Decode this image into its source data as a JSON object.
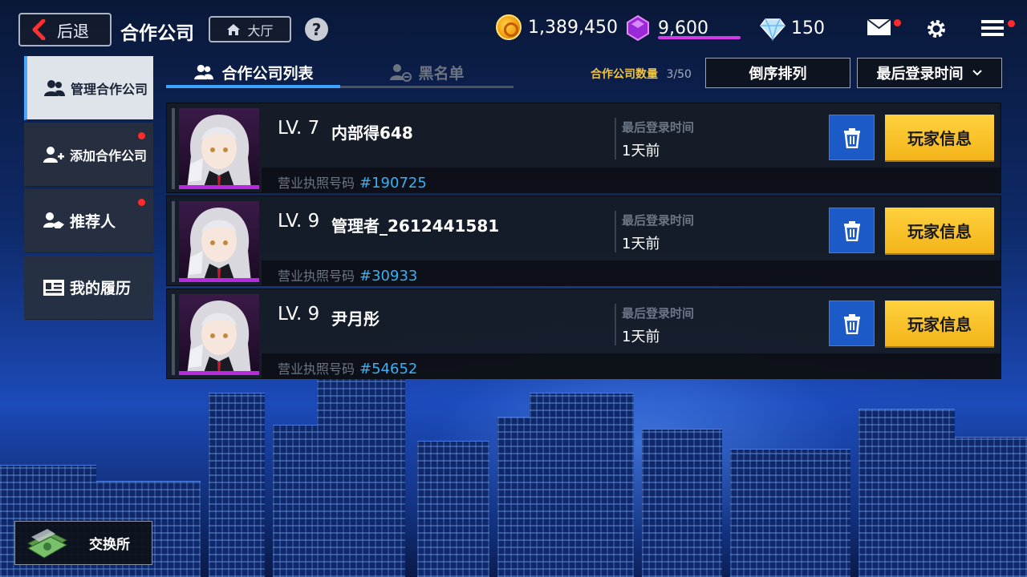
{
  "topbar": {
    "back_label": "后退",
    "title": "合作公司",
    "lobby_label": "大厅",
    "help_symbol": "?",
    "gold": "1,389,450",
    "purple_gems": "9,600",
    "diamonds": "150"
  },
  "sidebar": {
    "items": [
      {
        "label": "管理合作公司",
        "icon": "users-icon",
        "active": true
      },
      {
        "label": "添加合作公司",
        "icon": "add-user-icon",
        "badge": true
      },
      {
        "label": "推荐人",
        "icon": "handshake-icon",
        "badge": true
      },
      {
        "label": "我的履历",
        "icon": "profile-card-icon"
      }
    ],
    "exchange_label": "交换所"
  },
  "tabs": [
    {
      "label": "合作公司列表",
      "active": true
    },
    {
      "label": "黑名单",
      "active": false
    }
  ],
  "toolbar": {
    "count_label": "合作公司数量",
    "count_value": "3/50",
    "sort_order_label": "倒序排列",
    "sort_field_label": "最后登录时间"
  },
  "partners": [
    {
      "level": "LV. 7",
      "name": "内部得648",
      "license_label": "营业执照号码",
      "license": "#190725",
      "last_login_label": "最后登录时间",
      "last_login": "1天前",
      "info_label": "玩家信息"
    },
    {
      "level": "LV. 9",
      "name": "管理者_2612441581",
      "license_label": "营业执照号码",
      "license": "#30933",
      "last_login_label": "最后登录时间",
      "last_login": "1天前",
      "info_label": "玩家信息"
    },
    {
      "level": "LV. 9",
      "name": "尹月彤",
      "license_label": "营业执照号码",
      "license": "#54652",
      "last_login_label": "最后登录时间",
      "last_login": "1天前",
      "info_label": "玩家信息"
    }
  ],
  "colors": {
    "accent_blue": "#3aa4ff",
    "info_button": "#f3b41a",
    "delete_button": "#1c5ac8",
    "badge_red": "#ff2a2a",
    "count_label": "#f2c43a",
    "license_number": "#3ab0f0"
  }
}
